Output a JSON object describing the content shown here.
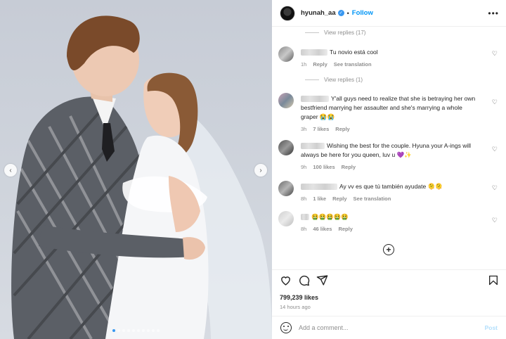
{
  "post": {
    "photo_icon": "wedding-photo",
    "dots_count": 10,
    "active_dot": 0
  },
  "header": {
    "username": "hyunah_aa",
    "separator": "•",
    "follow_label": "Follow",
    "more_label": "•••"
  },
  "comments": [
    {
      "replies_label": "View replies (17)"
    },
    {
      "text": "Tu novio está cool",
      "time": "1h",
      "reply": "Reply",
      "translate": "See translation",
      "replies_label": "View replies (1)"
    },
    {
      "text": "Y'all guys need to realize that she is betraying her own bestfriend marrying her assaulter and she's marrying a whole graper 😭😭",
      "time": "3h",
      "likes": "7 likes",
      "reply": "Reply"
    },
    {
      "text": "Wishing the best for the couple. Hyuna your A-ings will always be here for you queen, luv u 💜✨",
      "time": "9h",
      "likes": "100 likes",
      "reply": "Reply"
    },
    {
      "text": "Ay vv es que tú también ayudate 🫠🫠",
      "time": "8h",
      "likes": "1 like",
      "reply": "Reply",
      "translate": "See translation"
    },
    {
      "text": "🤮🤮🤮🤮🤮",
      "time": "8h",
      "likes": "46 likes",
      "reply": "Reply"
    }
  ],
  "actions": {
    "likes": "799,239 likes",
    "time_ago": "14 hours ago"
  },
  "add_comment": {
    "placeholder": "Add a comment...",
    "post_label": "Post"
  },
  "colors": {
    "accent": "#0095f6",
    "muted": "#8e8e8e",
    "text": "#262626"
  }
}
